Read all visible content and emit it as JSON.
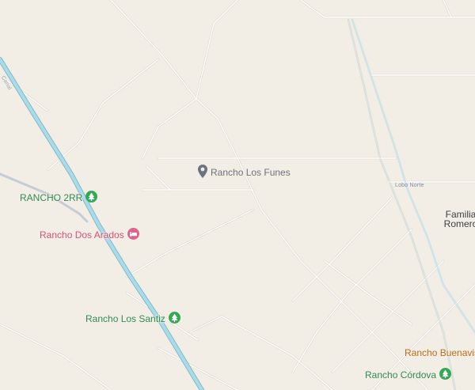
{
  "map": {
    "colors": {
      "land": "#f3eee5",
      "minor_road": "#ffffff",
      "minor_road_casing": "#dcd7cd",
      "highway": "#a8dcea",
      "highway_casing": "#86b8c8",
      "canal": "#c9e7f0",
      "poi_green": "#34a853",
      "poi_pink": "#e0638a",
      "poi_gray": "#6b7280",
      "poi_orange": "#e3942e"
    },
    "pois": [
      {
        "label": "Rancho Los Funes",
        "icon": "place-pin-icon"
      },
      {
        "label": "RANCHO 2RR",
        "icon": "tree-icon"
      },
      {
        "label": "Rancho Dos Arados",
        "icon": "bed-icon"
      },
      {
        "label": "Rancho Los Santiz",
        "icon": "tree-icon"
      },
      {
        "label": "Rancho Buenavista",
        "icon": "place-pin-icon"
      },
      {
        "label": "Rancho Córdova",
        "icon": "tree-icon"
      }
    ],
    "road_labels": [
      {
        "text": "Lobo Norte"
      },
      {
        "text": "Canal"
      }
    ],
    "places": [
      {
        "line1": "Familia",
        "line2": "Romero"
      }
    ]
  }
}
